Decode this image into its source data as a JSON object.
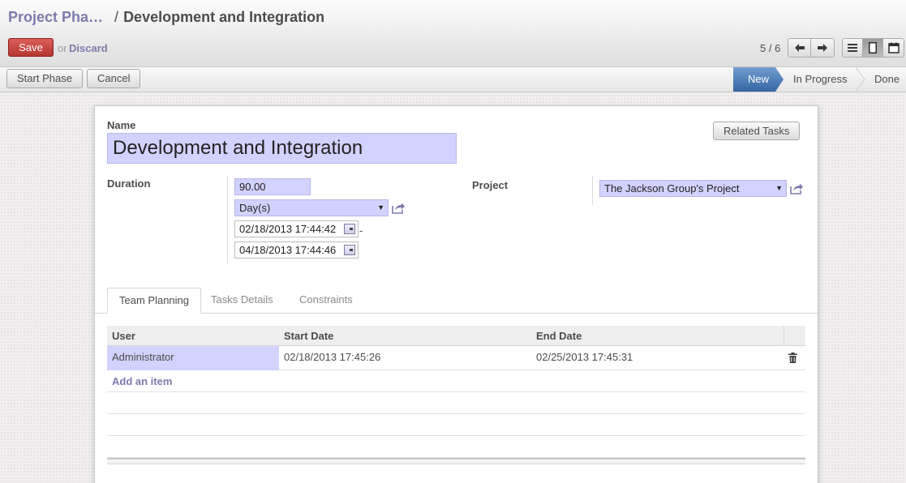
{
  "breadcrumb": {
    "parent": "Project Pha…",
    "separator": "/",
    "current": "Development and Integration"
  },
  "actions": {
    "save_label": "Save",
    "or_text": "or",
    "discard_label": "Discard"
  },
  "pager": {
    "text": "5 / 6",
    "prev_icon": "arrow-left-icon",
    "next_icon": "arrow-right-icon"
  },
  "view_switcher": {
    "icons": [
      "list-view-icon",
      "form-view-icon",
      "calendar-view-icon"
    ],
    "active": "form-view-icon"
  },
  "statusbar": {
    "buttons": [
      "Start Phase",
      "Cancel"
    ],
    "states": [
      "New",
      "In Progress",
      "Done"
    ],
    "current_state": "New"
  },
  "form": {
    "name_label": "Name",
    "name_value": "Development and Integration",
    "related_tasks_label": "Related Tasks",
    "duration_label": "Duration",
    "duration_value": "90.00",
    "duration_unit": "Day(s)",
    "date_start": "02/18/2013 17:44:42",
    "date_end": "04/18/2013 17:44:46",
    "date_separator": "-",
    "project_label": "Project",
    "project_value": "The Jackson Group's Project"
  },
  "tabs": [
    "Team Planning",
    "Tasks Details",
    "Constraints"
  ],
  "active_tab": "Team Planning",
  "team_table": {
    "columns": [
      "User",
      "Start Date",
      "End Date"
    ],
    "rows": [
      {
        "user": "Administrator",
        "start": "02/18/2013 17:45:26",
        "end": "02/25/2013 17:45:31"
      }
    ],
    "add_item_label": "Add an item",
    "delete_icon": "trash-icon"
  },
  "colors": {
    "accent": "#7c7bad",
    "required_field": "#d2d2ff",
    "save_button": "#c4403a",
    "state_active": "#3465a4"
  }
}
